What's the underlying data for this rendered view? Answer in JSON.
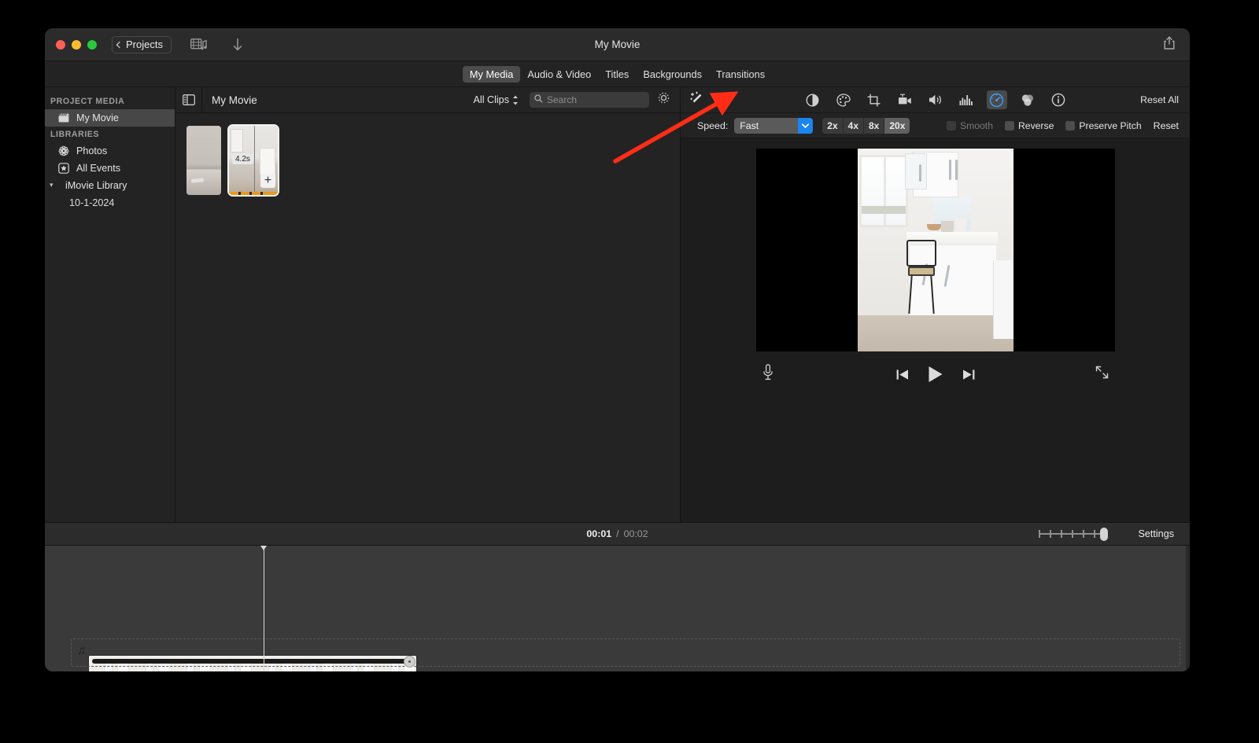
{
  "window": {
    "title": "My Movie",
    "back_label": "Projects",
    "back_icon": "chevron-left-icon",
    "media_icon": "filmstrip-music-icon",
    "download_icon": "download-arrow-icon",
    "share_icon": "share-icon"
  },
  "tabs": [
    {
      "label": "My Media",
      "active": true
    },
    {
      "label": "Audio & Video",
      "active": false
    },
    {
      "label": "Titles",
      "active": false
    },
    {
      "label": "Backgrounds",
      "active": false
    },
    {
      "label": "Transitions",
      "active": false
    }
  ],
  "sidebar": {
    "section_project": "PROJECT MEDIA",
    "section_libraries": "LIBRARIES",
    "items": [
      {
        "label": "My Movie",
        "icon": "clapperboard-icon",
        "selected": true
      },
      {
        "label": "Photos",
        "icon": "photos-flower-icon",
        "selected": false
      },
      {
        "label": "All Events",
        "icon": "star-square-icon",
        "selected": false
      },
      {
        "label": "iMovie Library",
        "icon": "chevron-down-icon",
        "selected": false
      },
      {
        "label": "10-1-2024",
        "icon": "",
        "selected": false
      }
    ]
  },
  "browser": {
    "panel_toggle_icon": "sidebar-toggle-icon",
    "title": "My Movie",
    "filter_label": "All Clips",
    "filter_icon": "sort-updown-icon",
    "search_icon": "search-icon",
    "search_placeholder": "Search",
    "search_value": "",
    "settings_icon": "gear-icon",
    "clips": [
      {
        "duration": "",
        "selected": false
      },
      {
        "duration": "4.2s",
        "selected": true,
        "add_icon": "plus-icon"
      }
    ]
  },
  "inspector": {
    "magic_icon": "auto-enhance-wand-icon",
    "reset_all_label": "Reset All",
    "tools": [
      {
        "name": "color-balance-icon",
        "active": false
      },
      {
        "name": "color-correction-palette-icon",
        "active": false
      },
      {
        "name": "crop-icon",
        "active": false
      },
      {
        "name": "stabilization-camera-icon",
        "active": false
      },
      {
        "name": "volume-icon",
        "active": false
      },
      {
        "name": "noise-reduction-equalizer-icon",
        "active": false
      },
      {
        "name": "speed-gauge-icon",
        "active": true
      },
      {
        "name": "clip-filter-icon",
        "active": false
      },
      {
        "name": "info-icon",
        "active": false
      }
    ],
    "speed": {
      "label": "Speed:",
      "selected": "Fast",
      "dropdown_icon": "chevron-down-icon",
      "multipliers": [
        {
          "label": "2x",
          "active": false
        },
        {
          "label": "4x",
          "active": false
        },
        {
          "label": "8x",
          "active": false
        },
        {
          "label": "20x",
          "active": true
        }
      ],
      "checkboxes": [
        {
          "label": "Smooth",
          "checked": false,
          "disabled": true
        },
        {
          "label": "Reverse",
          "checked": false,
          "disabled": false
        },
        {
          "label": "Preserve Pitch",
          "checked": false,
          "disabled": false
        }
      ],
      "reset_label": "Reset",
      "accent_color": "#1a84ef"
    }
  },
  "viewer": {
    "mic_icon": "microphone-icon",
    "prev_icon": "skip-to-start-icon",
    "play_icon": "play-icon",
    "next_icon": "skip-to-end-icon",
    "fullscreen_icon": "expand-arrows-icon"
  },
  "timeline_toolbar": {
    "current_time": "00:01",
    "separator": "/",
    "total_time": "00:02",
    "zoom_slider_icon": "zoom-slider",
    "settings_label": "Settings"
  },
  "timeline": {
    "clip_selected": true,
    "clip_color": "#1f62c4",
    "speed_icon": "rabbit-fast-icon",
    "speed_knob_icon": "speed-handle-icon",
    "audio_track_icon": "music-note-icon"
  },
  "annotation": {
    "arrow_color": "#ff2d16",
    "arrow_points": "from (920,152) to (1148,60)"
  }
}
